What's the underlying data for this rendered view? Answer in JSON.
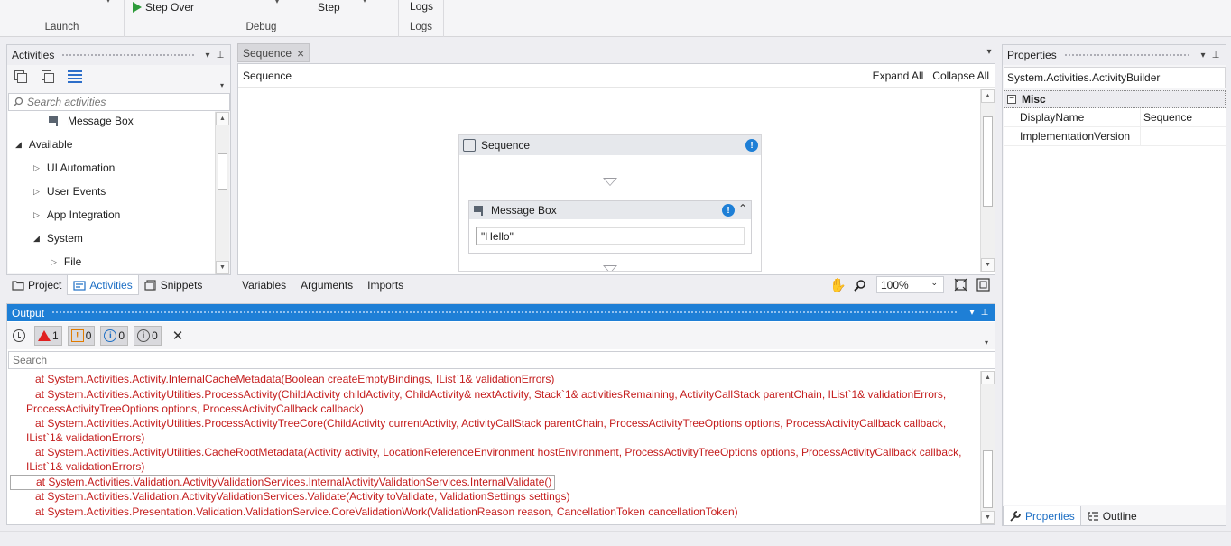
{
  "ribbon": {
    "groups": {
      "launch": "Launch",
      "debug": "Debug",
      "logs": "Logs"
    },
    "buttons": {
      "step_over": "Step Over",
      "step": "Step",
      "logs": "Logs"
    }
  },
  "activities_panel": {
    "title": "Activities",
    "search_placeholder": "Search activities",
    "tree": [
      {
        "label": "Message Box",
        "level": 2,
        "expanded": null
      },
      {
        "label": "Available",
        "level": 0,
        "expanded": true
      },
      {
        "label": "UI Automation",
        "level": 1,
        "expanded": false
      },
      {
        "label": "User Events",
        "level": 1,
        "expanded": false
      },
      {
        "label": "App Integration",
        "level": 1,
        "expanded": false
      },
      {
        "label": "System",
        "level": 1,
        "expanded": true
      },
      {
        "label": "File",
        "level": 2,
        "expanded": false
      }
    ],
    "bottom_tabs": [
      "Project",
      "Activities",
      "Snippets"
    ],
    "active_tab": "Activities"
  },
  "designer": {
    "tab_label": "Sequence",
    "breadcrumb": "Sequence",
    "expand_all": "Expand All",
    "collapse_all": "Collapse All",
    "sequence_title": "Sequence",
    "message_box": {
      "title": "Message Box",
      "value": "\"Hello\""
    },
    "footer_tabs": [
      "Variables",
      "Arguments",
      "Imports"
    ],
    "zoom": "100%"
  },
  "properties_panel": {
    "title": "Properties",
    "object": "System.Activities.ActivityBuilder",
    "category": "Misc",
    "rows": [
      {
        "name": "DisplayName",
        "value": "Sequence"
      },
      {
        "name": "ImplementationVersion",
        "value": ""
      }
    ],
    "bottom_tabs": [
      "Properties",
      "Outline"
    ]
  },
  "output_panel": {
    "title": "Output",
    "filters": {
      "errors": "1",
      "warnings": "0",
      "info": "0",
      "trace": "0"
    },
    "search_placeholder": "Search",
    "log_lines": [
      "at System.Activities.Activity.InternalCacheMetadata(Boolean createEmptyBindings, IList`1& validationErrors)",
      "at System.Activities.ActivityUtilities.ProcessActivity(ChildActivity childActivity, ChildActivity& nextActivity, Stack`1& activitiesRemaining, ActivityCallStack parentChain, IList`1& validationErrors, ProcessActivityTreeOptions options, ProcessActivityCallback callback)",
      "at System.Activities.ActivityUtilities.ProcessActivityTreeCore(ChildActivity currentActivity, ActivityCallStack parentChain, ProcessActivityTreeOptions options, ProcessActivityCallback callback, IList`1& validationErrors)",
      "at System.Activities.ActivityUtilities.CacheRootMetadata(Activity activity, LocationReferenceEnvironment hostEnvironment, ProcessActivityTreeOptions options, ProcessActivityCallback callback, IList`1& validationErrors)",
      "at System.Activities.Validation.ActivityValidationServices.InternalActivityValidationServices.InternalValidate()",
      "at System.Activities.Validation.ActivityValidationServices.Validate(Activity toValidate, ValidationSettings settings)",
      "at System.Activities.Presentation.Validation.ValidationService.CoreValidationWork(ValidationReason reason, CancellationToken cancellationToken)"
    ],
    "selected_line": 4,
    "colors": {
      "error_text": "#c41d1d",
      "accent": "#1e7fd6"
    }
  }
}
